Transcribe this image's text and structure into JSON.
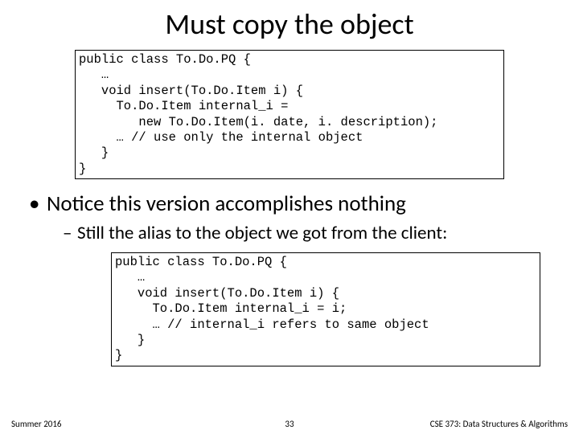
{
  "title": "Must copy the object",
  "code1": "public class To.Do.PQ {\n   …\n   void insert(To.Do.Item i) {\n     To.Do.Item internal_i =\n        new To.Do.Item(i. date, i. description);\n     … // use only the internal object\n   }\n}",
  "bullet": "Notice this version accomplishes nothing",
  "subbullet": "Still the alias to the object we got from the client:",
  "code2": "public class To.Do.PQ {\n   …\n   void insert(To.Do.Item i) {\n     To.Do.Item internal_i = i;\n     … // internal_i refers to same object\n   }\n}",
  "footer": {
    "left": "Summer 2016",
    "center": "33",
    "right": "CSE 373: Data Structures &\nAlgorithms"
  }
}
